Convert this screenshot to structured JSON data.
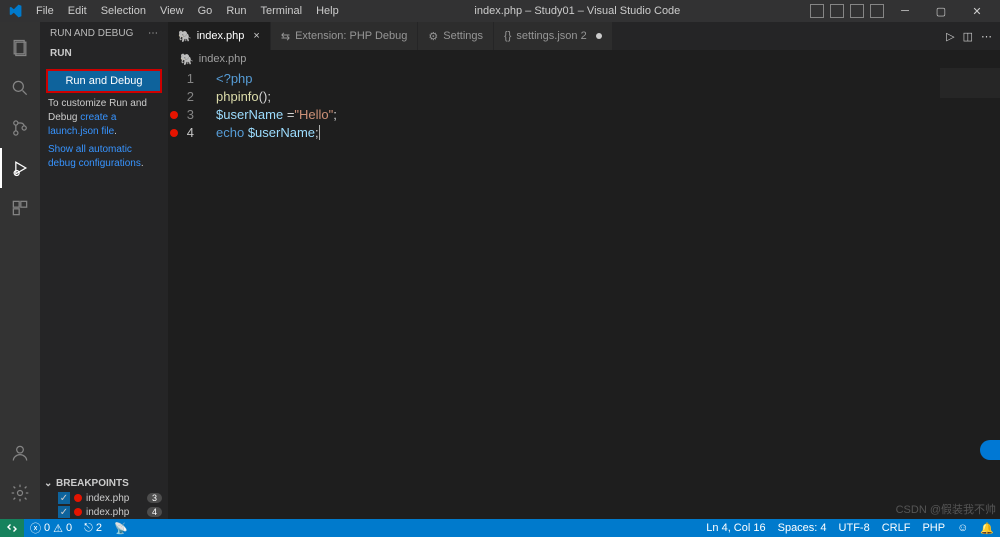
{
  "title": "index.php – Study01 – Visual Studio Code",
  "menu": [
    "File",
    "Edit",
    "Selection",
    "View",
    "Go",
    "Run",
    "Terminal",
    "Help"
  ],
  "sidebar": {
    "header": "RUN AND DEBUG",
    "section": "RUN",
    "button": "Run and Debug",
    "customize_pre": "To customize Run and Debug ",
    "customize_link": "create a launch.json file",
    "show_link": "Show all automatic debug configurations",
    "breakpoints_header": "BREAKPOINTS",
    "bp_items": [
      {
        "label": "index.php",
        "badge": "3"
      },
      {
        "label": "index.php",
        "badge": "4"
      }
    ]
  },
  "tabs": [
    {
      "icon": "🐘",
      "label": "index.php",
      "active": true,
      "close": "×"
    },
    {
      "icon": "⇆",
      "label": "Extension: PHP Debug"
    },
    {
      "icon": "⚙",
      "label": "Settings"
    },
    {
      "icon": "{}",
      "label": "settings.json 2",
      "modified": true
    }
  ],
  "breadcrumb": {
    "icon": "🐘",
    "file": "index.php"
  },
  "code": {
    "lines": [
      {
        "num": "1",
        "html": [
          [
            "k",
            "<?php"
          ]
        ]
      },
      {
        "num": "2",
        "html": [
          [
            "fn",
            "phpinfo"
          ],
          [
            "p",
            "();"
          ]
        ]
      },
      {
        "num": "3",
        "bp": true,
        "html": [
          [
            "v",
            "$userName"
          ],
          [
            "p",
            " ="
          ],
          [
            "s",
            "\"Hello\""
          ],
          [
            "p",
            ";"
          ]
        ]
      },
      {
        "num": "4",
        "bp": true,
        "active": true,
        "html": [
          [
            "k",
            "echo"
          ],
          [
            "p",
            " "
          ],
          [
            "v",
            "$userName"
          ],
          [
            "p",
            ";"
          ]
        ]
      }
    ]
  },
  "status": {
    "errors": "0",
    "warnings": "0",
    "port": "2",
    "ln_col": "Ln 4, Col 16",
    "spaces": "Spaces: 4",
    "encoding": "UTF-8",
    "eol": "CRLF",
    "lang": "PHP"
  },
  "watermark": "CSDN @假装我不帅"
}
